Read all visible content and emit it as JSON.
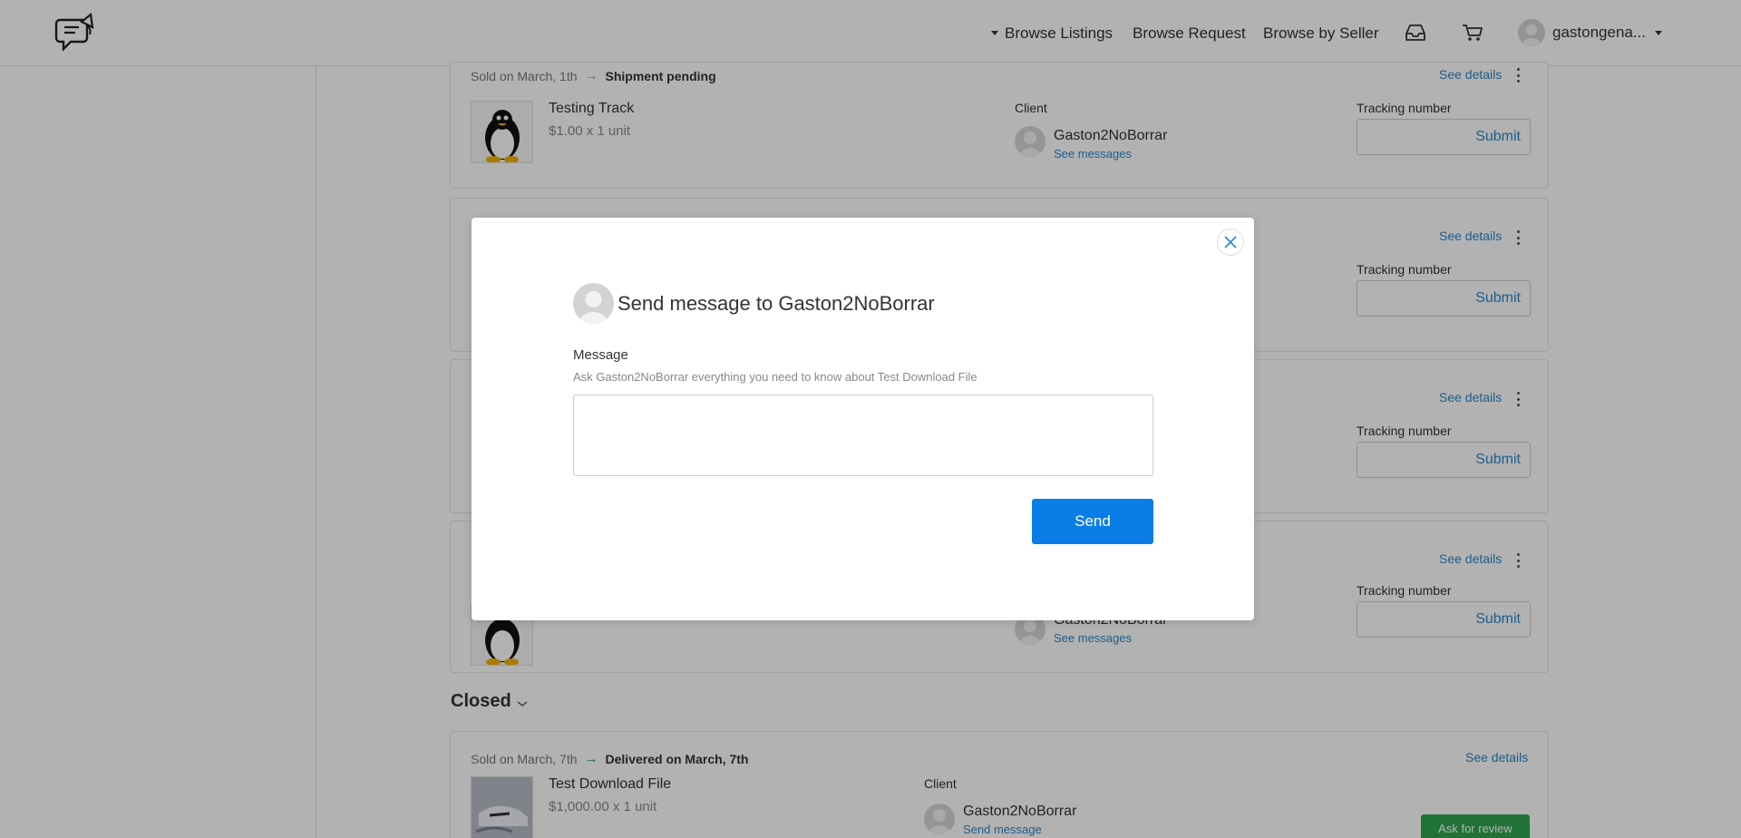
{
  "header": {
    "nav": {
      "browse_listings": "Browse Listings",
      "browse_request": "Browse Request",
      "browse_by_seller": "Browse by Seller"
    },
    "icons": [
      "logo-icon",
      "inbox-icon",
      "cart-icon",
      "user-avatar",
      "chevron-down-icon"
    ],
    "username": "gastongena..."
  },
  "orders": [
    {
      "sold_text": "Sold on March, 1th",
      "status": "Shipment pending",
      "see_details": "See details",
      "product_name": "Testing Track",
      "product_price": "$1.00 x 1 unit",
      "client_label": "Client",
      "client_name": "Gaston2NoBorrar",
      "client_link": "See messages",
      "tracking_label": "Tracking number",
      "submit": "Submit"
    },
    {
      "see_details": "See details",
      "tracking_label": "Tracking number",
      "submit": "Submit"
    },
    {
      "see_details": "See details",
      "tracking_label": "Tracking number",
      "submit": "Submit"
    },
    {
      "see_details": "See details",
      "client_name": "Gaston2NoBorrar",
      "client_link": "See messages",
      "tracking_label": "Tracking number",
      "submit": "Submit"
    }
  ],
  "closed": {
    "heading": "Closed",
    "order": {
      "sold_text": "Sold on March, 7th",
      "status": "Delivered on March, 7th",
      "see_details": "See details",
      "product_name": "Test Download File",
      "product_price": "$1,000.00 x 1 unit",
      "client_label": "Client",
      "client_name": "Gaston2NoBorrar",
      "client_link": "Send message",
      "review_button": "Ask for review"
    }
  },
  "modal": {
    "title": "Send message to Gaston2NoBorrar",
    "label": "Message",
    "hint": "Ask Gaston2NoBorrar everything you need to know about Test Download File",
    "message_value": "",
    "send": "Send"
  },
  "colors": {
    "link": "#2a87c8",
    "primary_button": "#0a7ee6",
    "review_button": "#2ea44f",
    "pending_arrow": "#e79b2b",
    "delivered_arrow": "#2a9a4b"
  }
}
